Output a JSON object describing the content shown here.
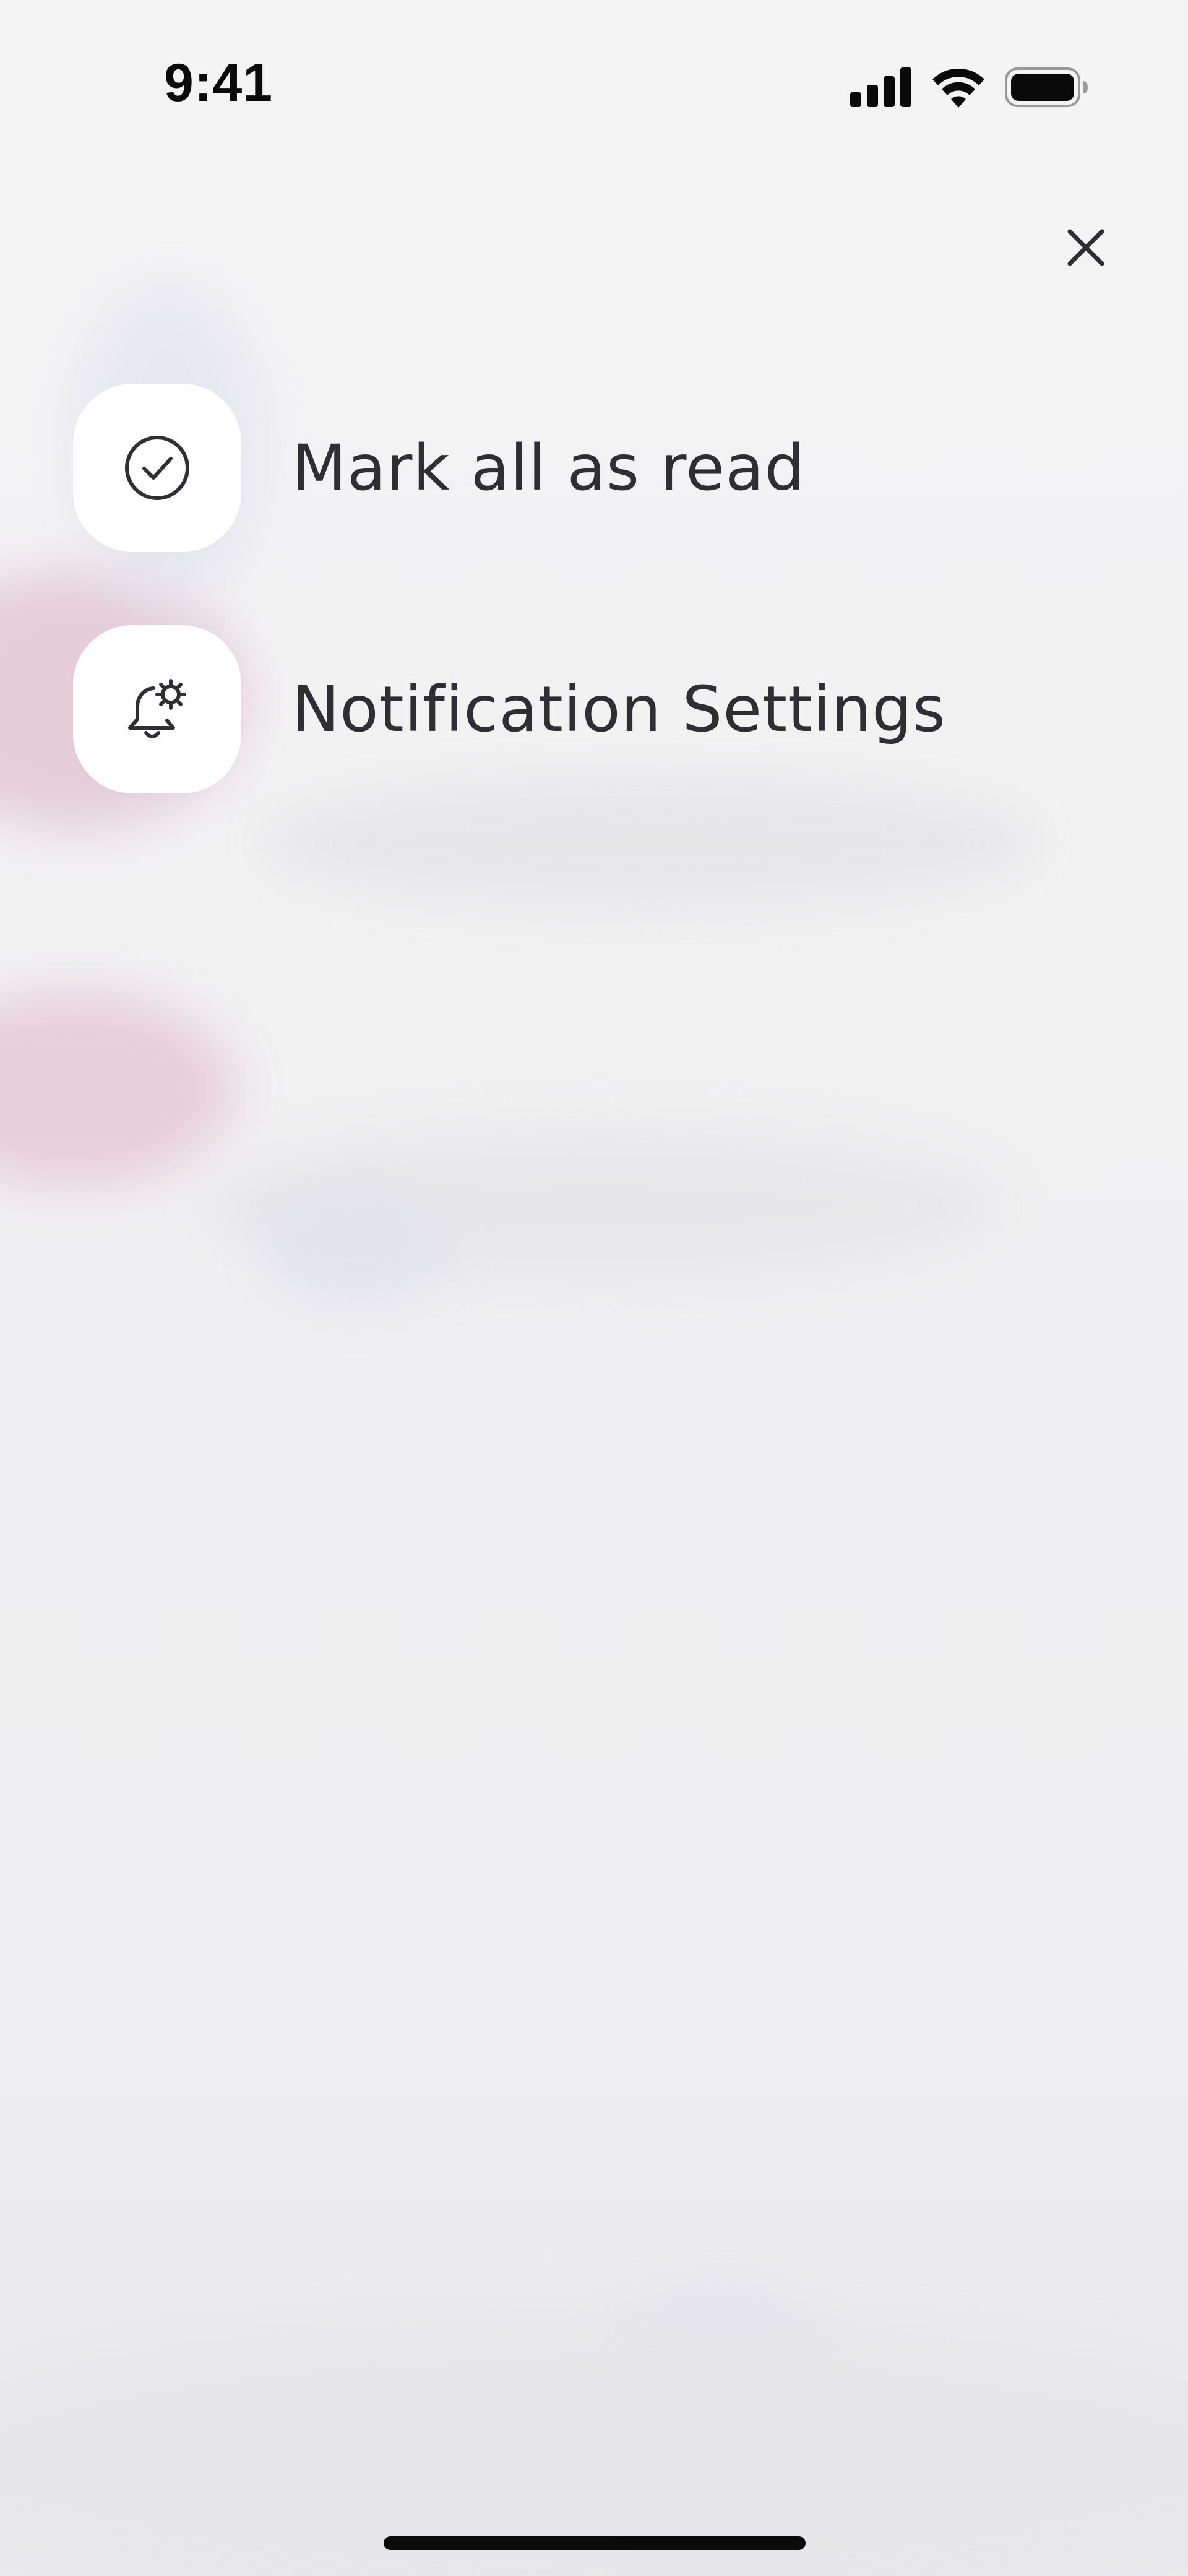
{
  "status_bar": {
    "time": "9:41",
    "icons": [
      "cellular-signal-icon",
      "wifi-icon",
      "battery-icon"
    ]
  },
  "close": {
    "icon": "close-icon"
  },
  "menu": {
    "items": [
      {
        "label": "Mark all as read",
        "icon": "check-circle-icon"
      },
      {
        "label": "Notification Settings",
        "icon": "bell-settings-icon"
      }
    ]
  },
  "colors": {
    "text": "#2e2e33",
    "tile": "#ffffff",
    "accent_pink": "#e6cdd6",
    "accent_lavender": "#e1e1ec"
  }
}
